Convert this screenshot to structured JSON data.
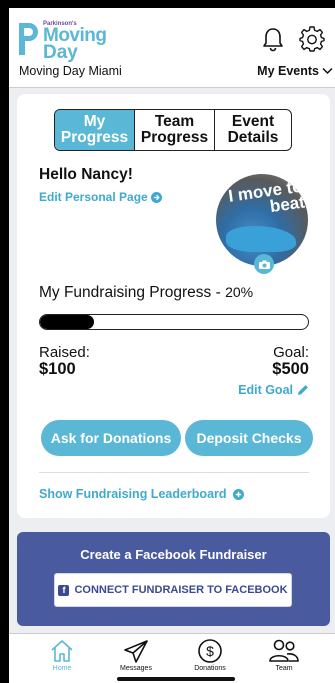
{
  "header": {
    "logo_small": "Parkinson's",
    "logo_line1": "Moving",
    "logo_line2": "Day",
    "event_name": "Moving Day Miami",
    "my_events_label": "My Events"
  },
  "tabs": [
    {
      "label": "My Progress",
      "active": true
    },
    {
      "label": "Team Progress",
      "active": false
    },
    {
      "label": "Event Details",
      "active": false
    }
  ],
  "profile": {
    "greeting": "Hello Nancy!",
    "edit_page_label": "Edit Personal Page",
    "photo_text": "I move to beat"
  },
  "fundraising": {
    "title": "My Fundraising Progress -",
    "percent_label": "20%",
    "percent": 0.2,
    "raised_label": "Raised:",
    "raised_value": "$100",
    "goal_label": "Goal:",
    "goal_value": "$500",
    "edit_goal_label": "Edit Goal"
  },
  "actions": {
    "ask_label": "Ask for Donations",
    "deposit_label": "Deposit Checks",
    "leaderboard_label": "Show Fundraising Leaderboard"
  },
  "facebook": {
    "title": "Create a Facebook Fundraiser",
    "button_label": "CONNECT FUNDRAISER TO FACEBOOK"
  },
  "nav": [
    {
      "label": "Home",
      "icon": "home-icon",
      "active": true
    },
    {
      "label": "Messages",
      "icon": "paper-plane-icon",
      "active": false
    },
    {
      "label": "Donations",
      "icon": "dollar-icon",
      "active": false
    },
    {
      "label": "Team",
      "icon": "team-icon",
      "active": false
    }
  ],
  "colors": {
    "accent": "#5ab8d6",
    "link": "#3fa9cf",
    "facebook_panel": "#4a5a9e"
  }
}
